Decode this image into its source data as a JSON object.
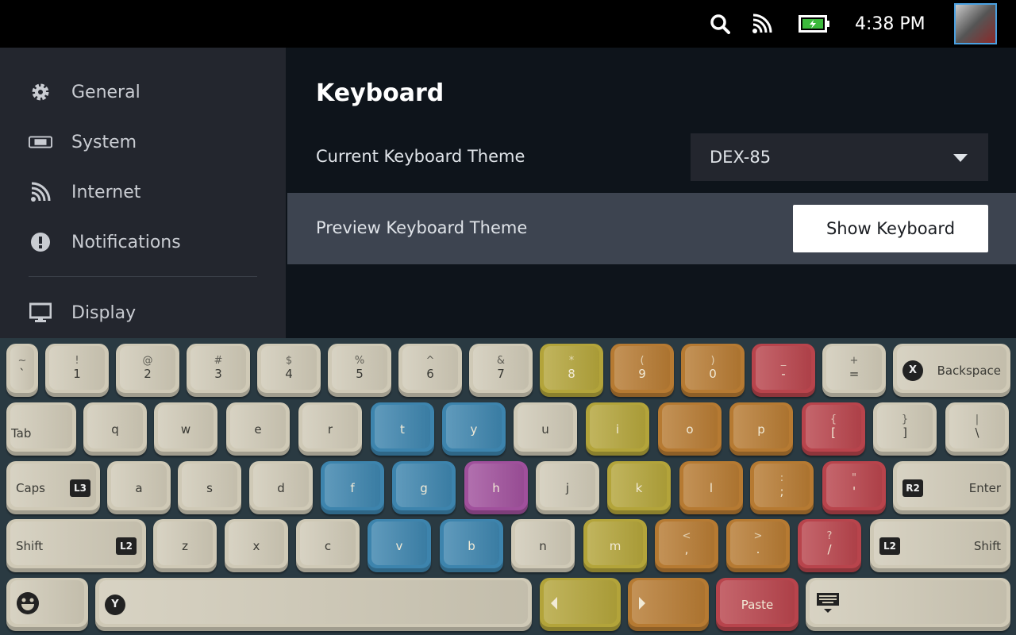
{
  "topbar": {
    "clock": "4:38 PM",
    "icons": [
      "search-icon",
      "wifi-icon",
      "battery-charging-icon"
    ],
    "battery_color": "#3cb93c"
  },
  "sidebar": {
    "items": [
      {
        "label": "General",
        "icon": "gear-icon"
      },
      {
        "label": "System",
        "icon": "system-icon"
      },
      {
        "label": "Internet",
        "icon": "wifi-icon"
      },
      {
        "label": "Notifications",
        "icon": "alert-icon"
      },
      {
        "label": "Display",
        "icon": "monitor-icon"
      }
    ]
  },
  "main": {
    "title": "Keyboard",
    "current_theme_label": "Current Keyboard Theme",
    "current_theme_value": "DEX-85",
    "preview_label": "Preview Keyboard Theme",
    "show_keyboard_button": "Show Keyboard"
  },
  "keyboard": {
    "colors": {
      "cream": "#cfc9b6",
      "blue": "#3d84ad",
      "purple": "#a0509c",
      "yellow": "#b3a43a",
      "orange": "#b67a32",
      "red": "#b8444c"
    },
    "rows": [
      [
        {
          "s": "~",
          "m": "`",
          "c": "cream"
        },
        {
          "s": "!",
          "m": "1",
          "c": "cream"
        },
        {
          "s": "@",
          "m": "2",
          "c": "cream"
        },
        {
          "s": "#",
          "m": "3",
          "c": "cream"
        },
        {
          "s": "$",
          "m": "4",
          "c": "cream"
        },
        {
          "s": "%",
          "m": "5",
          "c": "cream"
        },
        {
          "s": "^",
          "m": "6",
          "c": "cream"
        },
        {
          "s": "&",
          "m": "7",
          "c": "cream"
        },
        {
          "s": "*",
          "m": "8",
          "c": "yellow"
        },
        {
          "s": "(",
          "m": "9",
          "c": "orange"
        },
        {
          "s": ")",
          "m": "0",
          "c": "orange"
        },
        {
          "s": "_",
          "m": "-",
          "c": "red"
        },
        {
          "s": "+",
          "m": "=",
          "c": "cream"
        },
        {
          "m": "Backspace",
          "c": "cream",
          "badge": "X"
        }
      ],
      [
        {
          "m": "Tab",
          "c": "cream"
        },
        {
          "m": "q",
          "c": "cream"
        },
        {
          "m": "w",
          "c": "cream"
        },
        {
          "m": "e",
          "c": "cream"
        },
        {
          "m": "r",
          "c": "cream"
        },
        {
          "m": "t",
          "c": "blue"
        },
        {
          "m": "y",
          "c": "blue"
        },
        {
          "m": "u",
          "c": "cream"
        },
        {
          "m": "i",
          "c": "yellow"
        },
        {
          "m": "o",
          "c": "orange"
        },
        {
          "m": "p",
          "c": "orange"
        },
        {
          "s": "{",
          "m": "[",
          "c": "red"
        },
        {
          "s": "}",
          "m": "]",
          "c": "cream"
        },
        {
          "s": "|",
          "m": "\\",
          "c": "cream"
        }
      ],
      [
        {
          "m": "Caps",
          "c": "cream",
          "badge": "L3"
        },
        {
          "m": "a",
          "c": "cream"
        },
        {
          "m": "s",
          "c": "cream"
        },
        {
          "m": "d",
          "c": "cream"
        },
        {
          "m": "f",
          "c": "blue"
        },
        {
          "m": "g",
          "c": "blue"
        },
        {
          "m": "h",
          "c": "purple"
        },
        {
          "m": "j",
          "c": "cream"
        },
        {
          "m": "k",
          "c": "yellow"
        },
        {
          "m": "l",
          "c": "orange"
        },
        {
          "s": ":",
          "m": ";",
          "c": "orange"
        },
        {
          "s": "\"",
          "m": "'",
          "c": "red"
        },
        {
          "m": "Enter",
          "c": "cream",
          "badge": "R2"
        }
      ],
      [
        {
          "m": "Shift",
          "c": "cream",
          "badge": "L2"
        },
        {
          "m": "z",
          "c": "cream"
        },
        {
          "m": "x",
          "c": "cream"
        },
        {
          "m": "c",
          "c": "cream"
        },
        {
          "m": "v",
          "c": "blue"
        },
        {
          "m": "b",
          "c": "blue"
        },
        {
          "m": "n",
          "c": "cream"
        },
        {
          "m": "m",
          "c": "yellow"
        },
        {
          "s": "<",
          "m": ",",
          "c": "orange"
        },
        {
          "s": ">",
          "m": ".",
          "c": "orange"
        },
        {
          "s": "?",
          "m": "/",
          "c": "red"
        },
        {
          "m": "Shift",
          "c": "cream",
          "badge": "L2"
        }
      ],
      [
        {
          "m": "",
          "c": "cream",
          "icon": "emoji-icon"
        },
        {
          "m": "",
          "c": "cream",
          "badge": "Y"
        },
        {
          "m": "",
          "c": "yellow",
          "icon": "arrow-left-icon"
        },
        {
          "m": "",
          "c": "orange",
          "icon": "arrow-right-icon"
        },
        {
          "m": "Paste",
          "c": "red"
        },
        {
          "m": "",
          "c": "cream",
          "icon": "hide-keyboard-icon"
        }
      ]
    ]
  }
}
